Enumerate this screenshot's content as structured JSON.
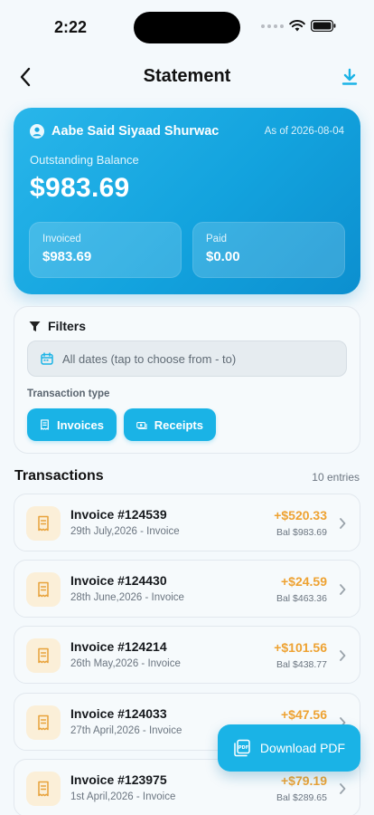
{
  "status_bar": {
    "time": "2:22"
  },
  "header": {
    "title": "Statement"
  },
  "balance_card": {
    "customer_name": "Aabe Said Siyaad Shurwac",
    "as_of": "As of 2026-08-04",
    "outstanding_label": "Outstanding Balance",
    "outstanding_amount": "$983.69",
    "invoiced_label": "Invoiced",
    "invoiced_amount": "$983.69",
    "paid_label": "Paid",
    "paid_amount": "$0.00"
  },
  "filters": {
    "title": "Filters",
    "date_placeholder": "All dates (tap to choose from - to)",
    "transaction_type_label": "Transaction type",
    "chips": [
      {
        "label": "Invoices"
      },
      {
        "label": "Receipts"
      }
    ]
  },
  "transactions": {
    "heading": "Transactions",
    "count": "10 entries",
    "items": [
      {
        "title": "Invoice #124539",
        "subtitle": "29th July,2026 - Invoice",
        "amount": "+$520.33",
        "balance": "Bal $983.69"
      },
      {
        "title": "Invoice #124430",
        "subtitle": "28th June,2026 - Invoice",
        "amount": "+$24.59",
        "balance": "Bal $463.36"
      },
      {
        "title": "Invoice #124214",
        "subtitle": "26th May,2026 - Invoice",
        "amount": "+$101.56",
        "balance": "Bal $438.77"
      },
      {
        "title": "Invoice #124033",
        "subtitle": "27th April,2026 - Invoice",
        "amount": "+$47.56",
        "balance": ""
      },
      {
        "title": "Invoice #123975",
        "subtitle": "1st April,2026 - Invoice",
        "amount": "+$79.19",
        "balance": "Bal $289.65"
      }
    ]
  },
  "fab": {
    "label": "Download PDF"
  },
  "colors": {
    "accent": "#1ab3e6",
    "amount": "#eea232",
    "icon_bg": "#fbefd8"
  }
}
